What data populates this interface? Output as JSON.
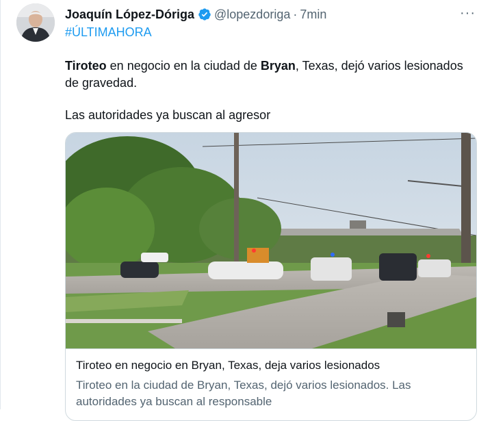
{
  "tweet": {
    "author_name": "Joaquín López-Dóriga",
    "handle": "@lopezdoriga",
    "separator": "·",
    "time": "7min",
    "more": "···",
    "hashtag": "#ÚLTIMAHORA",
    "paragraph1": {
      "bold1": "Tiroteo",
      "text1": " en negocio en la ciudad de ",
      "bold2": "Bryan",
      "text2": ", Texas, dejó varios lesionados de gravedad."
    },
    "paragraph2": "Las autoridades ya buscan al agresor"
  },
  "card": {
    "title": "Tiroteo en negocio en Bryan, Texas, deja varios lesionados",
    "description": "Tiroteo en la ciudad de Bryan, Texas, dejó varios lesionados. Las autoridades ya buscan al responsable"
  },
  "colors": {
    "accent": "#1d9bf0",
    "secondary_text": "#536471",
    "primary_text": "#0f1419"
  },
  "icons": [
    "verified-badge-icon",
    "more-options-icon"
  ]
}
